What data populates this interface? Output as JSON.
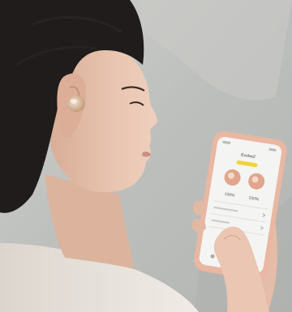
{
  "colors": {
    "wall": "#bfc0bd",
    "wall_dark": "#a9aaa7",
    "skin": "#e7c2ad",
    "skin_shadow": "#d3a892",
    "hair": "#1f1c1b",
    "shirt": "#e8e2dc",
    "phone_case": "#e9b7a2",
    "screen": "#f4f4f3",
    "earbud": "#d9b79a",
    "accent": "#f2d33c"
  },
  "phone_screen": {
    "title": "Evolve2",
    "left_percent": "100%",
    "right_percent": "100%",
    "left_level": 1.0,
    "right_level": 1.0
  },
  "icons": [
    "earbud-icon",
    "battery-icon",
    "chevron-right-icon",
    "home-icon",
    "settings-icon"
  ]
}
